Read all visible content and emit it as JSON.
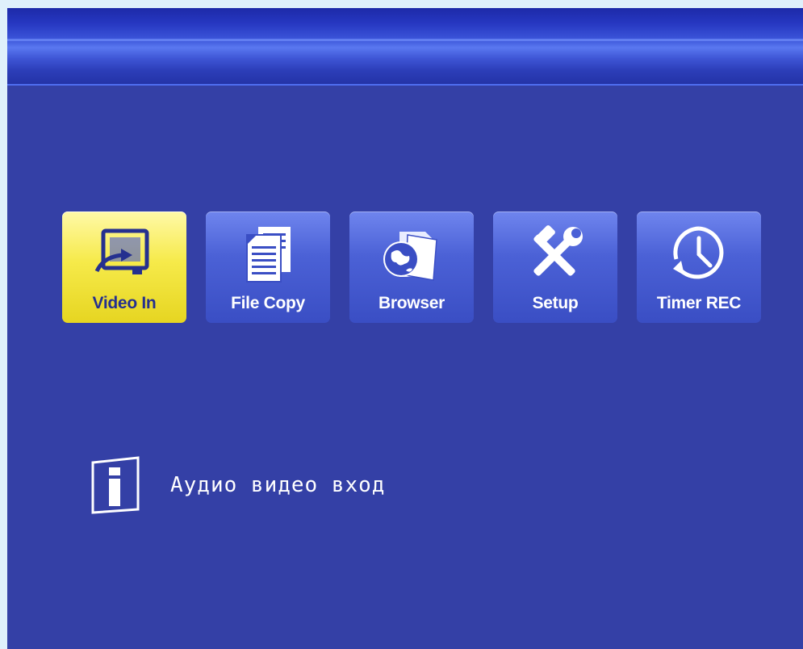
{
  "menu": {
    "items": [
      {
        "label": "Video In",
        "icon": "video-in-icon",
        "selected": true
      },
      {
        "label": "File Copy",
        "icon": "file-copy-icon",
        "selected": false
      },
      {
        "label": "Browser",
        "icon": "browser-icon",
        "selected": false
      },
      {
        "label": "Setup",
        "icon": "setup-icon",
        "selected": false
      },
      {
        "label": "Timer REC",
        "icon": "timer-rec-icon",
        "selected": false
      }
    ]
  },
  "info": {
    "icon": "info-icon",
    "text": "Аудио видео вход"
  },
  "colors": {
    "background": "#3440a6",
    "tile": "#4b61d6",
    "selected_tile": "#f6ea4a",
    "selected_label": "#25308f"
  }
}
